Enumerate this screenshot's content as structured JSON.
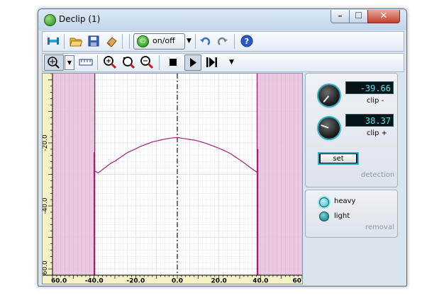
{
  "window": {
    "title": "Declip (1)"
  },
  "toolbar": {
    "onoff_label": "on/off"
  },
  "chart_data": {
    "type": "line",
    "xlim": [
      -60,
      60
    ],
    "xticks": [
      -60,
      -40,
      -20,
      0,
      20,
      40,
      60
    ],
    "xtick_labels": [
      "60.0",
      "-40.0",
      "-20.0",
      "0.0",
      "20.0",
      "40.0",
      "60"
    ],
    "yticks": [
      -20,
      -40,
      -60
    ],
    "ytick_labels": [
      "-20.0",
      "-40.0",
      "-60.0"
    ],
    "ylim": [
      -62,
      2
    ],
    "grid": true,
    "clip_regions": [
      [
        -60,
        -39.66
      ],
      [
        38.37,
        60
      ]
    ],
    "clip_edges": [
      -39.66,
      38.37
    ],
    "center_line": 0,
    "series": [
      {
        "x": [
          -40,
          -39.66,
          -38,
          -36,
          -34,
          -32,
          -30,
          -28,
          -26,
          -24,
          -22,
          -20,
          -18,
          -16,
          -14,
          -12,
          -10,
          -8,
          -6,
          -4,
          -2,
          0,
          2,
          4,
          6,
          8,
          10,
          12,
          14,
          16,
          18,
          20,
          22,
          24,
          26,
          28,
          30,
          32,
          34,
          36,
          38,
          38.37,
          38.7
        ],
        "y": [
          -23,
          -29,
          -29.5,
          -28.5,
          -27.5,
          -26.5,
          -25.8,
          -24.9,
          -24,
          -23.1,
          -22.5,
          -21.9,
          -21.2,
          -20.7,
          -20.2,
          -19.7,
          -19.4,
          -19.1,
          -18.8,
          -18.6,
          -18.4,
          -18.3,
          -18.5,
          -18.7,
          -18.9,
          -19.1,
          -19.4,
          -19.8,
          -20.2,
          -20.7,
          -21.2,
          -21.7,
          -22.3,
          -22.9,
          -23.6,
          -24.5,
          -25.4,
          -26.3,
          -27.3,
          -28.3,
          -29.2,
          -29,
          -22
        ]
      }
    ]
  },
  "detection": {
    "clip_minus_value": "-39.66",
    "clip_minus_label": "clip -",
    "clip_plus_value": "38.37",
    "clip_plus_label": "clip +",
    "set_label": "set",
    "section_label": "detection"
  },
  "removal": {
    "heavy_label": "heavy",
    "light_label": "light",
    "selected": "heavy",
    "section_label": "removal"
  },
  "colors": {
    "clip_fill": "#e8c3de",
    "curve": "#a0207a",
    "grid": "#e1e1e1",
    "lcd_text": "#4fe3f4",
    "knob_ring": "#27b3c9"
  }
}
